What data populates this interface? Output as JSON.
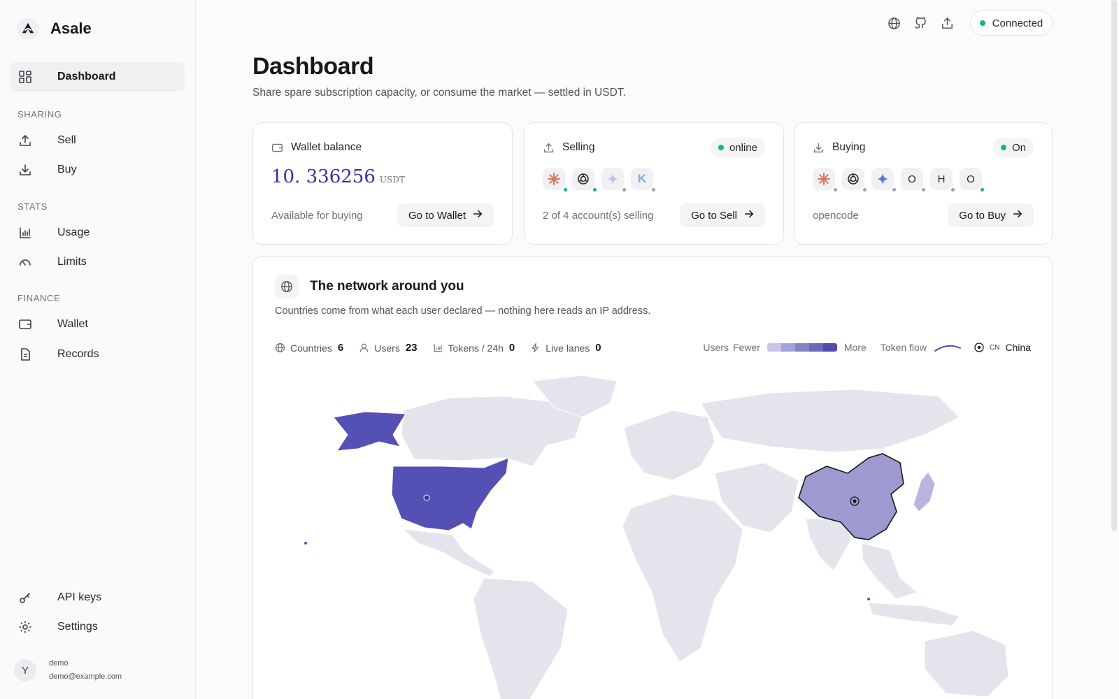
{
  "app": {
    "name": "Asale"
  },
  "sidebar": {
    "dashboard": "Dashboard",
    "sections": {
      "sharing": "SHARING",
      "stats": "STATS",
      "finance": "FINANCE"
    },
    "items": {
      "sell": "Sell",
      "buy": "Buy",
      "usage": "Usage",
      "limits": "Limits",
      "wallet": "Wallet",
      "records": "Records",
      "api_keys": "API keys",
      "settings": "Settings"
    },
    "user": {
      "initial": "Y",
      "name": "demo",
      "email": "demo@example.com"
    }
  },
  "topbar": {
    "status": "Connected",
    "icons": [
      "globe-icon",
      "github-icon",
      "share-icon"
    ]
  },
  "header": {
    "title": "Dashboard",
    "subtitle": "Share spare subscription capacity, or consume the market — settled in USDT."
  },
  "wallet_card": {
    "title": "Wallet balance",
    "balance": "10. 336256",
    "unit": "USDT",
    "note": "Available for buying",
    "button": "Go to Wallet"
  },
  "selling_card": {
    "title": "Selling",
    "status": "online",
    "summary": "2 of 4 account(s) selling",
    "button": "Go to Sell",
    "providers": [
      {
        "icon": "claude-icon",
        "online": true
      },
      {
        "icon": "openai-icon",
        "online": true
      },
      {
        "icon": "gemini-icon",
        "online": false
      },
      {
        "icon": "kimi-icon",
        "label": "K",
        "online": false
      }
    ]
  },
  "buying_card": {
    "title": "Buying",
    "status": "On",
    "summary": "opencode",
    "button": "Go to Buy",
    "providers": [
      {
        "icon": "claude-icon",
        "online": false
      },
      {
        "icon": "openai-icon",
        "online": false
      },
      {
        "icon": "gemini-icon",
        "online": false
      },
      {
        "label": "O",
        "online": false
      },
      {
        "label": "H",
        "online": false
      },
      {
        "label": "O",
        "online": true
      }
    ]
  },
  "network": {
    "title": "The network around you",
    "subtitle": "Countries come from what each user declared — nothing here reads an IP address.",
    "stats": {
      "countries_label": "Countries",
      "countries": "6",
      "users_label": "Users",
      "users": "23",
      "tokens_label": "Tokens / 24h",
      "tokens": "0",
      "lanes_label": "Live lanes",
      "lanes": "0"
    },
    "legend": {
      "users": "Users",
      "fewer": "Fewer",
      "more": "More",
      "token_flow": "Token flow",
      "selected_code": "CN",
      "selected_name": "China"
    },
    "colors": {
      "land": "#e4e4ec",
      "high": "#5450b4",
      "mid": "#9c9ad0",
      "low": "#b8b6e0"
    }
  }
}
